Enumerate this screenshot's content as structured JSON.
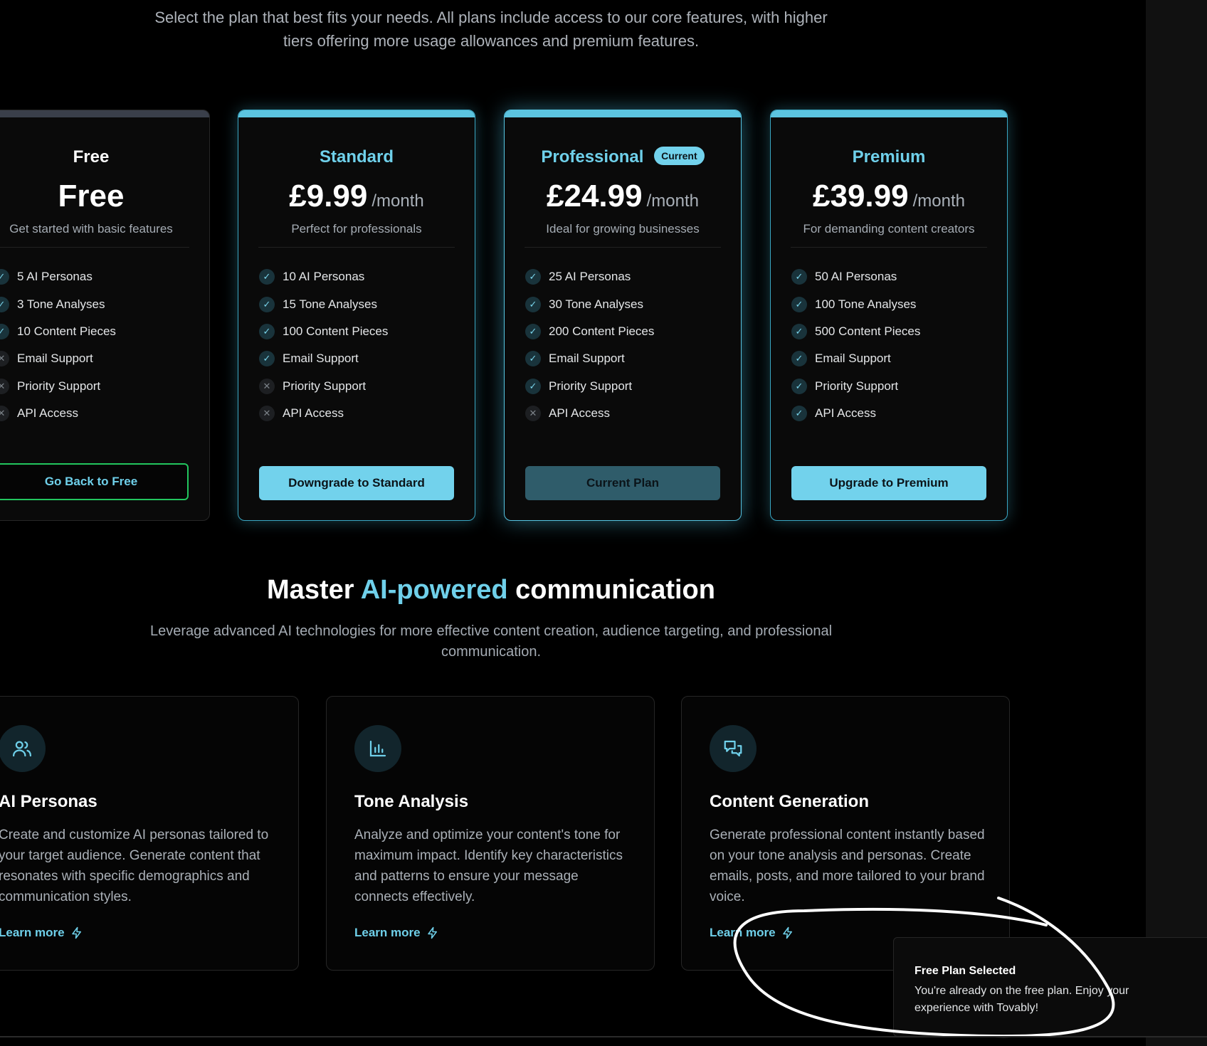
{
  "intro": {
    "line1": "Select the plan that best fits your needs. All plans include access to our core features, with higher",
    "line2": "tiers offering more usage allowances and premium features."
  },
  "plans": [
    {
      "name": "Free",
      "price": "Free",
      "period": "",
      "description": "Get started with basic features",
      "features": [
        {
          "label": "5 AI Personas",
          "included": true
        },
        {
          "label": "3 Tone Analyses",
          "included": true
        },
        {
          "label": "10 Content Pieces",
          "included": true
        },
        {
          "label": "Email Support",
          "included": false
        },
        {
          "label": "Priority Support",
          "included": false
        },
        {
          "label": "API Access",
          "included": false
        }
      ],
      "button": "Go Back to Free"
    },
    {
      "name": "Standard",
      "price": "£9.99",
      "period": "/month",
      "description": "Perfect for professionals",
      "features": [
        {
          "label": "10 AI Personas",
          "included": true
        },
        {
          "label": "15 Tone Analyses",
          "included": true
        },
        {
          "label": "100 Content Pieces",
          "included": true
        },
        {
          "label": "Email Support",
          "included": true
        },
        {
          "label": "Priority Support",
          "included": false
        },
        {
          "label": "API Access",
          "included": false
        }
      ],
      "button": "Downgrade to Standard"
    },
    {
      "name": "Professional",
      "badge": "Current",
      "price": "£24.99",
      "period": "/month",
      "description": "Ideal for growing businesses",
      "features": [
        {
          "label": "25 AI Personas",
          "included": true
        },
        {
          "label": "30 Tone Analyses",
          "included": true
        },
        {
          "label": "200 Content Pieces",
          "included": true
        },
        {
          "label": "Email Support",
          "included": true
        },
        {
          "label": "Priority Support",
          "included": true
        },
        {
          "label": "API Access",
          "included": false
        }
      ],
      "button": "Current Plan"
    },
    {
      "name": "Premium",
      "price": "£39.99",
      "period": "/month",
      "description": "For demanding content creators",
      "features": [
        {
          "label": "50 AI Personas",
          "included": true
        },
        {
          "label": "100 Tone Analyses",
          "included": true
        },
        {
          "label": "500 Content Pieces",
          "included": true
        },
        {
          "label": "Email Support",
          "included": true
        },
        {
          "label": "Priority Support",
          "included": true
        },
        {
          "label": "API Access",
          "included": true
        }
      ],
      "button": "Upgrade to Premium"
    }
  ],
  "section": {
    "title_pre": "Master ",
    "title_accent": "AI-powered",
    "title_post": " communication",
    "subtitle_line1": "Leverage advanced AI technologies for more effective content creation, audience targeting, and professional",
    "subtitle_line2": "communication."
  },
  "features": [
    {
      "icon": "users-icon",
      "title": "AI Personas",
      "description": "Create and customize AI personas tailored to your target audience. Generate content that resonates with specific demographics and communication styles.",
      "link": "Learn more"
    },
    {
      "icon": "bar-chart-icon",
      "title": "Tone Analysis",
      "description": "Analyze and optimize your content's tone for maximum impact. Identify key characteristics and patterns to ensure your message connects effectively.",
      "link": "Learn more"
    },
    {
      "icon": "chat-bubbles-icon",
      "title": "Content Generation",
      "description": "Generate professional content instantly based on your tone analysis and personas. Create emails, posts, and more tailored to your brand voice.",
      "link": "Learn more"
    }
  ],
  "toast": {
    "title": "Free Plan Selected",
    "message": "You're already on the free plan. Enjoy your experience with Tovably!"
  },
  "colors": {
    "accent": "#6fd0ea",
    "background": "#000000",
    "card": "#0a0a0a",
    "free_border": "#22c55e"
  }
}
